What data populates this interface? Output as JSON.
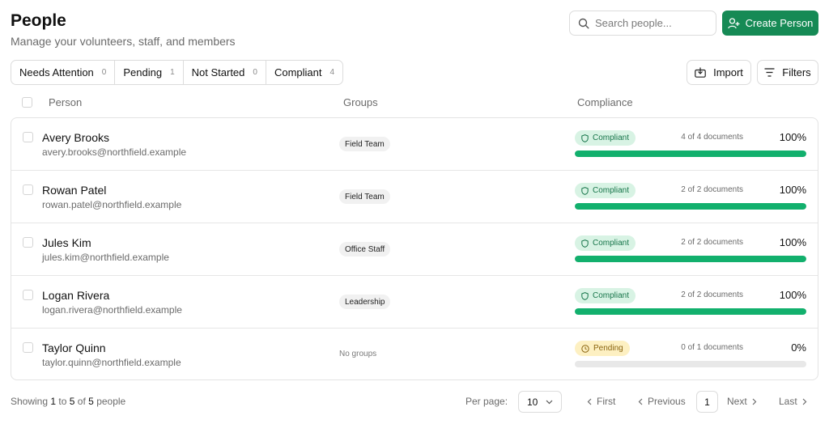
{
  "header": {
    "title": "People",
    "subtitle": "Manage your volunteers, staff, and members"
  },
  "search": {
    "placeholder": "Search people..."
  },
  "create_button": {
    "label": "Create Person",
    "icon": "user-plus-icon",
    "color": "#168a55"
  },
  "filter_tabs": [
    {
      "label": "Needs Attention",
      "count": "0"
    },
    {
      "label": "Pending",
      "count": "1"
    },
    {
      "label": "Not Started",
      "count": "0"
    },
    {
      "label": "Compliant",
      "count": "4"
    }
  ],
  "toolbar": {
    "import_label": "Import",
    "import_icon": "import-icon",
    "filters_label": "Filters",
    "filters_icon": "filter-lines-icon"
  },
  "table": {
    "columns": [
      "Person",
      "Groups",
      "Compliance"
    ],
    "rows": [
      {
        "name": "Avery Brooks",
        "email": "avery.brooks@northfield.example",
        "group": "Field Team",
        "status": "Compliant",
        "status_type": "compliant",
        "documents": "4 of 4 documents",
        "percent": "100%",
        "progress": 1.0
      },
      {
        "name": "Rowan Patel",
        "email": "rowan.patel@northfield.example",
        "group": "Field Team",
        "status": "Compliant",
        "status_type": "compliant",
        "documents": "2 of 2 documents",
        "percent": "100%",
        "progress": 1.0
      },
      {
        "name": "Jules Kim",
        "email": "jules.kim@northfield.example",
        "group": "Office Staff",
        "status": "Compliant",
        "status_type": "compliant",
        "documents": "2 of 2 documents",
        "percent": "100%",
        "progress": 1.0
      },
      {
        "name": "Logan Rivera",
        "email": "logan.rivera@northfield.example",
        "group": "Leadership",
        "status": "Compliant",
        "status_type": "compliant",
        "documents": "2 of 2 documents",
        "percent": "100%",
        "progress": 1.0
      },
      {
        "name": "Taylor Quinn",
        "email": "taylor.quinn@northfield.example",
        "group": "No groups",
        "status": "Pending",
        "status_type": "pending",
        "documents": "0 of 1 documents",
        "percent": "0%",
        "progress": 0.0
      }
    ]
  },
  "colors": {
    "compliant_badge_bg": "#d8f3e4",
    "compliant_badge_text": "#17754a",
    "pending_badge_bg": "#fdf0c2",
    "pending_badge_text": "#8a6410",
    "progress_fill": "#12b06d",
    "progress_track": "#e8e8e8"
  },
  "footer": {
    "showing_prefix": "Showing",
    "from": "1",
    "to_word": "to",
    "to": "5",
    "of_word": "of",
    "total": "5",
    "suffix": "people",
    "per_page_label": "Per page:",
    "per_page_value": "10",
    "first_label": "First",
    "previous_label": "Previous",
    "current_page": "1",
    "next_label": "Next",
    "last_label": "Last"
  }
}
